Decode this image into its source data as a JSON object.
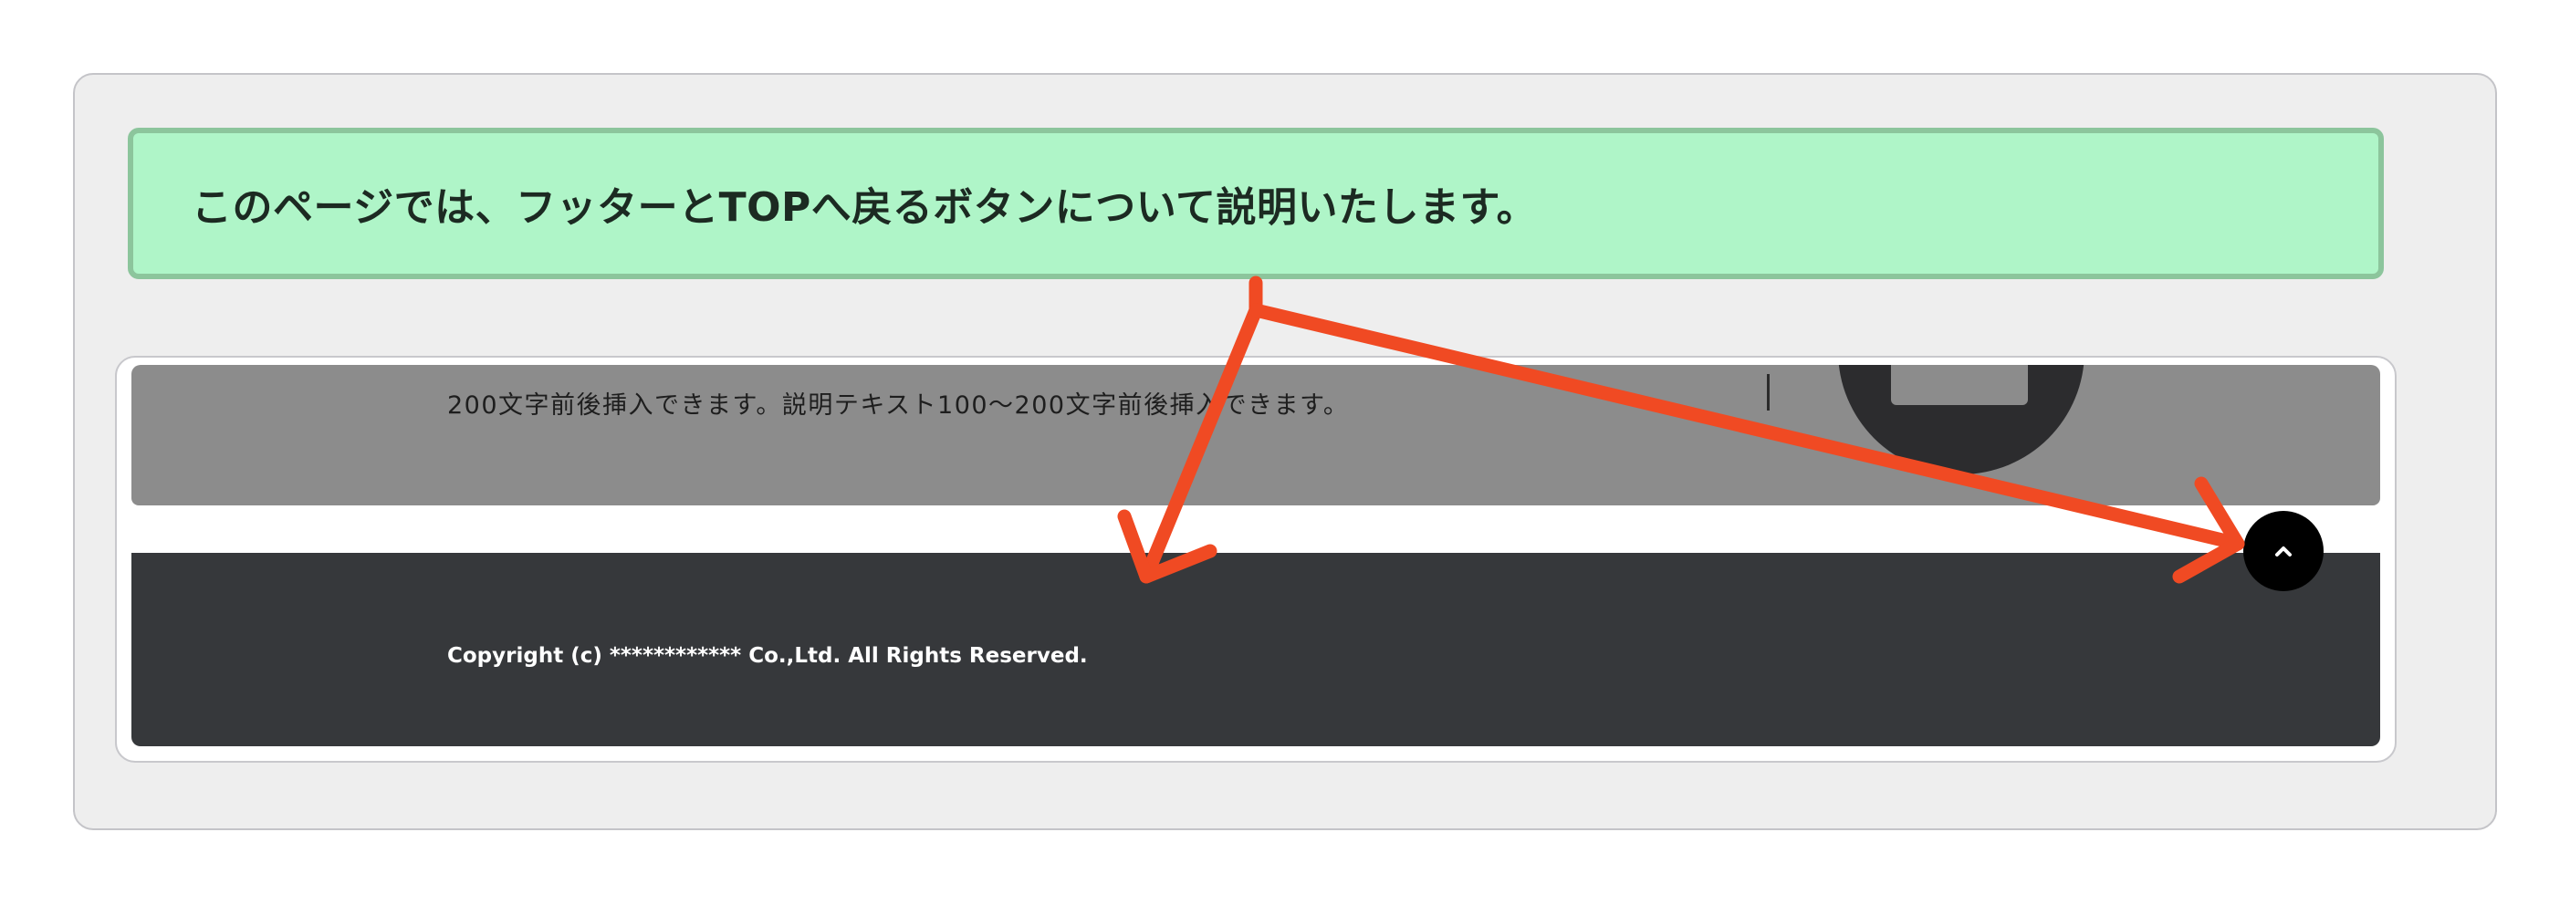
{
  "callout": {
    "text": "このページでは、フッターとTOPへ戻るボタンについて説明いたします。"
  },
  "section": {
    "description": "200文字前後挿入できます。説明テキスト100〜200文字前後挿入できます。"
  },
  "footer": {
    "copyright": "Copyright (c) ************ Co.,Ltd. All Rights Reserved."
  },
  "back_to_top": {
    "icon": "chevron-up-icon"
  },
  "annotation": {
    "arrow_color": "#f04a23"
  },
  "colors": {
    "callout_bg": "#aff5c8",
    "callout_border": "#8cc59c",
    "gray_section": "#8c8c8c",
    "footer_bg": "#36383b",
    "panel_bg": "#eeeeee"
  }
}
